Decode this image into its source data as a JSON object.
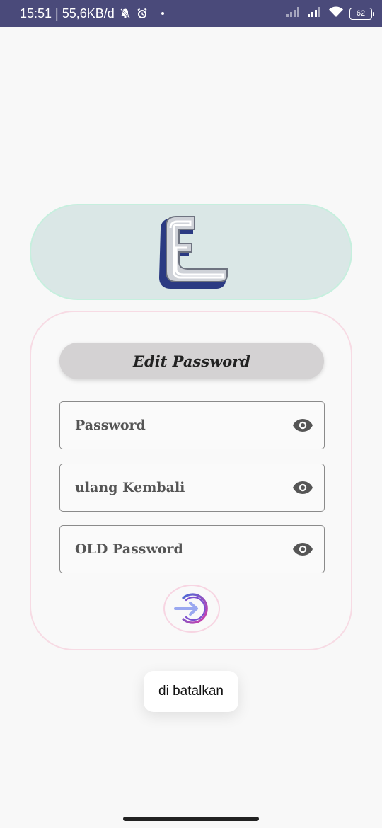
{
  "status_bar": {
    "time_speed": "15:51 | 55,6KB/d",
    "battery": "62",
    "icons": [
      "bell-off-icon",
      "alarm-icon",
      "signal-icon",
      "signal-icon",
      "wifi-icon",
      "battery-icon"
    ]
  },
  "logo": {
    "letter": "E",
    "icon": "logo-e"
  },
  "form": {
    "title": "Edit Password",
    "fields": [
      {
        "placeholder": "Password",
        "value": ""
      },
      {
        "placeholder": "ulang Kembali",
        "value": ""
      },
      {
        "placeholder": "OLD Password",
        "value": ""
      }
    ],
    "submit_icon": "login-arrow-icon"
  },
  "toast": {
    "message": "di batalkan"
  },
  "colors": {
    "status_bar": "#4a4a7a",
    "logo_card_bg": "#dae7e6",
    "logo_card_border": "#c6efde",
    "form_card_border": "#f7dbe4",
    "title_pill_bg": "#d4d2d3",
    "logo_blue": "#2b3a82"
  }
}
